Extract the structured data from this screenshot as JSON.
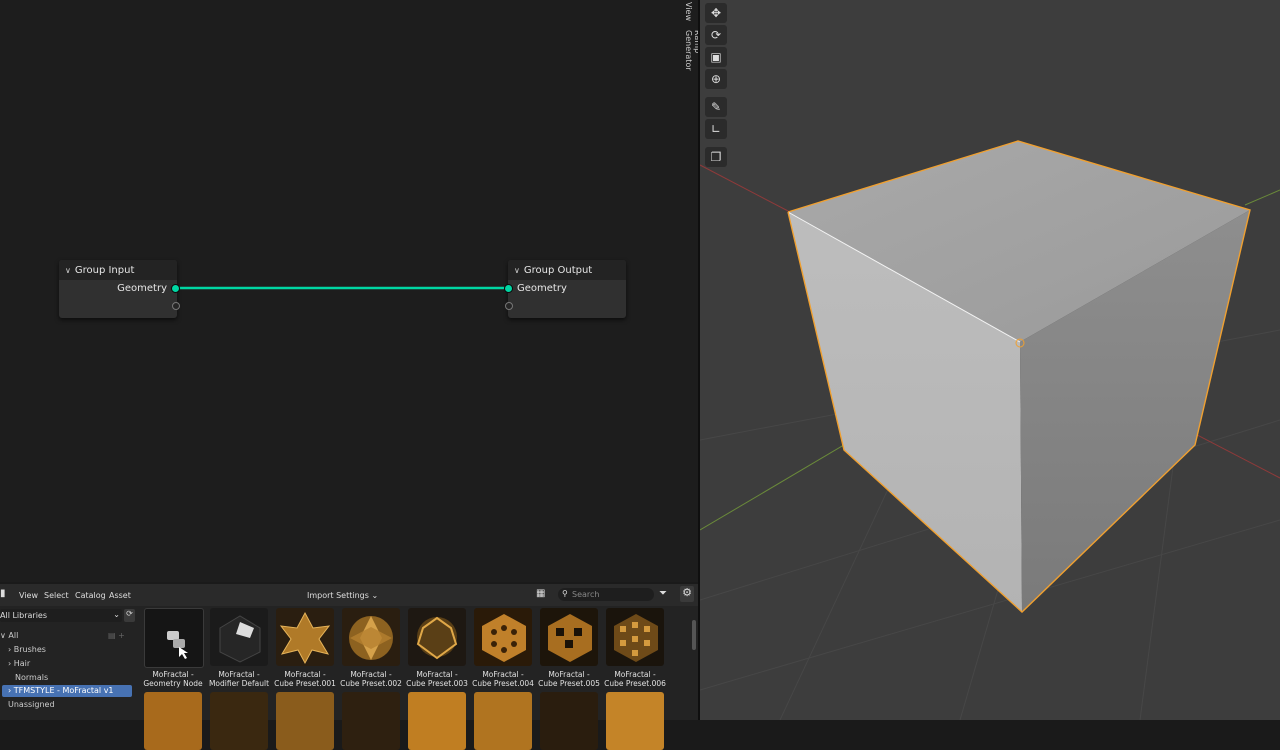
{
  "node_editor": {
    "sidebar_tabs": [
      "View",
      "Ramp Generator"
    ],
    "nodes": {
      "group_input": {
        "title": "Group Input",
        "socket": "Geometry"
      },
      "group_output": {
        "title": "Group Output",
        "socket": "Geometry"
      }
    },
    "link_color": "#00d6a3"
  },
  "viewport": {
    "selection_color": "#f0a030",
    "tools": [
      "move-icon",
      "rotate-icon",
      "scale-icon",
      "transform-icon",
      "annotate-icon",
      "measure-icon",
      "add-cube-icon"
    ]
  },
  "asset_browser": {
    "menu": [
      "View",
      "Select",
      "Catalog",
      "Asset"
    ],
    "import_settings": "Import Settings",
    "search_placeholder": "Search",
    "library": "All Libraries",
    "tree": [
      {
        "label": "All"
      },
      {
        "label": "Brushes"
      },
      {
        "label": "Hair"
      },
      {
        "label": "Normals"
      },
      {
        "label": "TFMSTYLE - MoFractal v1"
      },
      {
        "label": "Unassigned"
      }
    ],
    "assets": [
      {
        "line1": "MoFractal -",
        "line2": "Geometry Node"
      },
      {
        "line1": "MoFractal -",
        "line2": "Modifier Default"
      },
      {
        "line1": "MoFractal -",
        "line2": "Cube Preset.001"
      },
      {
        "line1": "MoFractal -",
        "line2": "Cube Preset.002"
      },
      {
        "line1": "MoFractal -",
        "line2": "Cube Preset.003"
      },
      {
        "line1": "MoFractal -",
        "line2": "Cube Preset.004"
      },
      {
        "line1": "MoFractal -",
        "line2": "Cube Preset.005"
      },
      {
        "line1": "MoFractal -",
        "line2": "Cube Preset.006"
      }
    ]
  }
}
